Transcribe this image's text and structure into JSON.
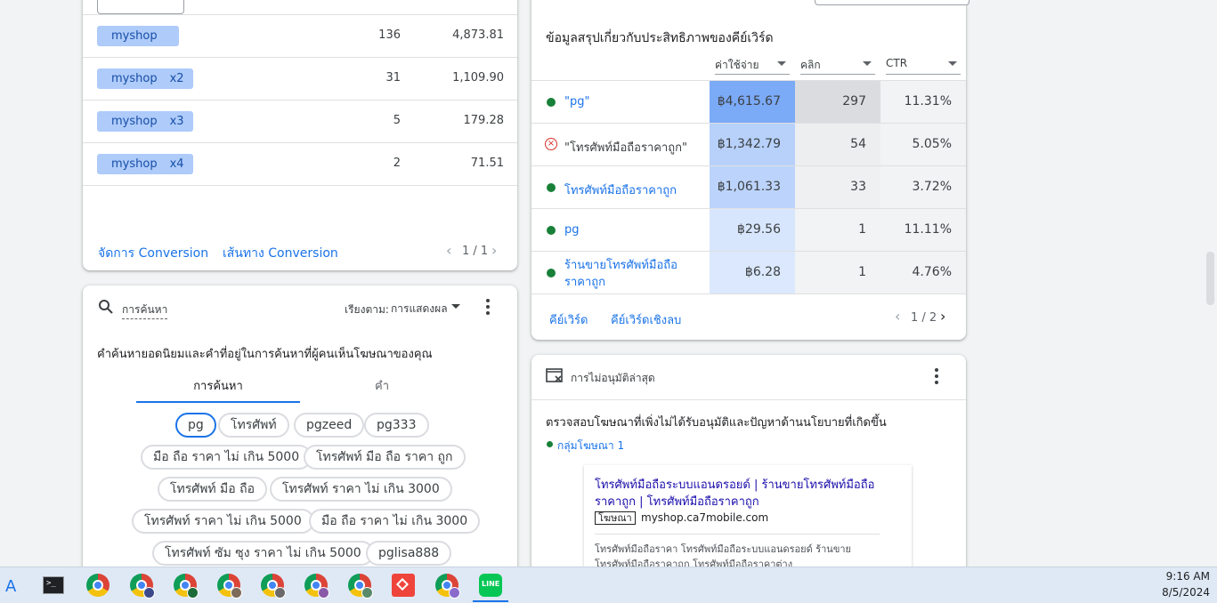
{
  "conversion_card": {
    "rows": [
      {
        "label": "myshop",
        "mult": "",
        "a": "136",
        "b": "4,873.81"
      },
      {
        "label": "myshop",
        "mult": "x2",
        "a": "31",
        "b": "1,109.90"
      },
      {
        "label": "myshop",
        "mult": "x3",
        "a": "5",
        "b": "179.28"
      },
      {
        "label": "myshop",
        "mult": "x4",
        "a": "2",
        "b": "71.51"
      }
    ],
    "manage_link": "จัดการ Conversion",
    "path_link": "เส้นทาง Conversion",
    "pager": "1 / 1"
  },
  "search_card": {
    "header_label": "การค้นหา",
    "sort_prefix": "เรียงตาม:",
    "sort_value": "การแสดงผล",
    "description": "คำค้นหายอดนิยมและคำที่อยู่ในการค้นหาที่ผู้คนเห็นโฆษณาของคุณ",
    "tabs": [
      "การค้นหา",
      "คำ"
    ],
    "chips": [
      "pg",
      "โทรศัพท์",
      "pgzeed",
      "pg333",
      "มือ ถือ ราคา ไม่ เกิน 5000",
      "โทรศัพท์ มือ ถือ ราคา ถูก",
      "โทรศัพท์ มือ ถือ",
      "โทรศัพท์ ราคา ไม่ เกิน 3000",
      "โทรศัพท์ ราคา ไม่ เกิน 5000",
      "มือ ถือ ราคา ไม่ เกิน 3000",
      "โทรศัพท์ ซัม ซุง ราคา ไม่ เกิน 5000",
      "pglisa888"
    ]
  },
  "keyword_card": {
    "title": "ข้อมูลสรุปเกี่ยวกับประสิทธิภาพของคีย์เวิร์ด",
    "columns": [
      "ค่าใช้จ่าย",
      "คลิก",
      "CTR"
    ],
    "rows": [
      {
        "status": "active",
        "keyword": "\"pg\"",
        "cost": "฿4,615.67",
        "clicks": "297",
        "ctr": "11.31%",
        "cost_level": 1.0,
        "click_level": 1.0
      },
      {
        "status": "error",
        "keyword": "\"โทรศัพท์มือถือราคาถูก\"",
        "cost": "฿1,342.79",
        "clicks": "54",
        "ctr": "5.05%",
        "cost_level": 0.45,
        "click_level": 0.2
      },
      {
        "status": "active",
        "keyword": "โทรศัพท์มือถือราคาถูก",
        "cost": "฿1,061.33",
        "clicks": "33",
        "ctr": "3.72%",
        "cost_level": 0.4,
        "click_level": 0.15
      },
      {
        "status": "active",
        "keyword": "pg",
        "cost": "฿29.56",
        "clicks": "1",
        "ctr": "11.11%",
        "cost_level": 0.15,
        "click_level": 0.0
      },
      {
        "status": "active",
        "keyword": "ร้านขายโทรศัพท์มือถือราคาถูก",
        "cost": "฿6.28",
        "clicks": "1",
        "ctr": "4.76%",
        "cost_level": 0.12,
        "click_level": 0.0
      }
    ],
    "link_keywords": "คีย์เวิร์ด",
    "link_negative": "คีย์เวิร์ดเชิงลบ",
    "pager": "1 / 2"
  },
  "disapproval_card": {
    "title": "การไม่อนุมัติล่าสุด",
    "description": "ตรวจสอบโฆษณาที่เพิ่งไม่ได้รับอนุมัติและปัญหาด้านนโยบายที่เกิดขึ้น",
    "group_label": "กลุ่มโฆษณา 1",
    "ad_headline": "โทรศัพท์มือถือระบบแอนดรอยด์ | ร้านขายโทรศัพท์มือถือราคาถูก | โทรศัพท์มือถือราคาถูก",
    "ad_badge": "โฆษณา",
    "ad_url": "myshop.ca7mobile.com",
    "ad_desc": "โทรศัพท์มือถือราคา โทรศัพท์มือถือระบบแอนดรอยด์ ร้านขายโทรศัพท์มือถือราคาถูก โทรศัพท์มือถือราคาต่าง"
  },
  "taskbar": {
    "time": "9:16 AM",
    "date": "8/5/2024",
    "icons": [
      "start-icon",
      "terminal-icon",
      "chrome-icon",
      "chrome-profile-icon",
      "chrome-profile-icon",
      "chrome-profile-icon",
      "chrome-profile-icon",
      "chrome-profile-icon",
      "chrome-profile-icon",
      "anydesk-icon",
      "chrome-profile-icon",
      "line-icon"
    ]
  }
}
